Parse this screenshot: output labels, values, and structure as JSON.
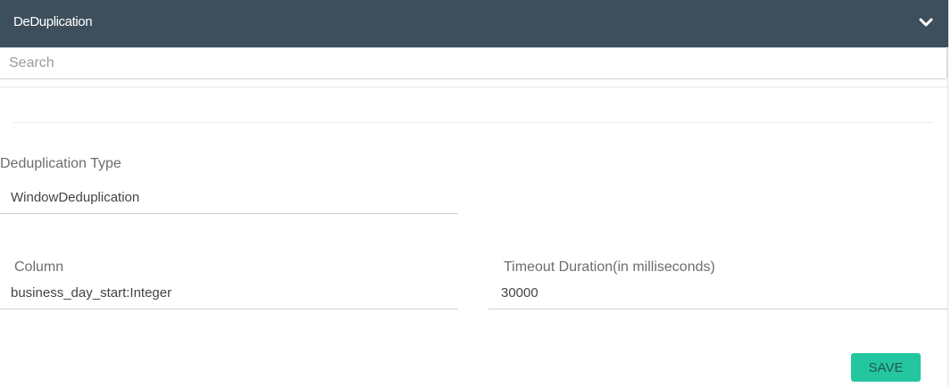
{
  "header": {
    "title": "DeDuplication",
    "toggle_icon": "chevron-down-icon"
  },
  "search": {
    "placeholder": "Search",
    "value": ""
  },
  "form": {
    "dedup_type": {
      "label": "Deduplication Type",
      "value": "WindowDeduplication"
    },
    "column": {
      "label": "Column",
      "value": "business_day_start:Integer"
    },
    "timeout": {
      "label": "Timeout Duration(in milliseconds)",
      "value": "30000"
    }
  },
  "actions": {
    "save_label": "SAVE"
  },
  "colors": {
    "header_bg": "#3d4f5c",
    "save_bg": "#24c6a0"
  }
}
